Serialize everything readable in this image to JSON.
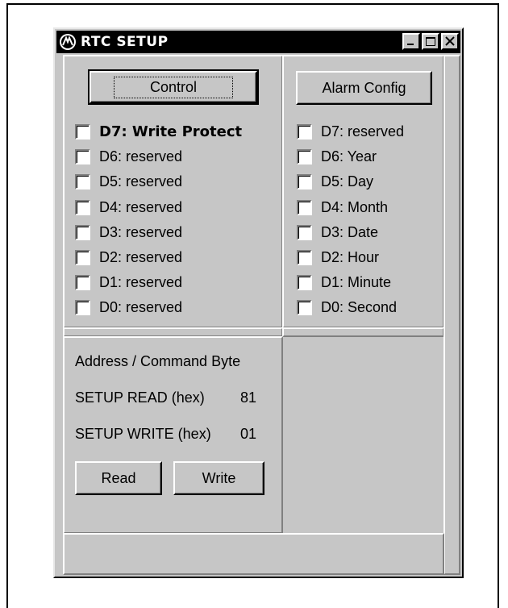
{
  "window": {
    "title": "RTC SETUP"
  },
  "control": {
    "button_label": "Control",
    "bits": [
      {
        "label": "D7: Write Protect",
        "checked": false,
        "bold": true
      },
      {
        "label": "D6: reserved",
        "checked": false
      },
      {
        "label": "D5: reserved",
        "checked": false
      },
      {
        "label": "D4: reserved",
        "checked": false
      },
      {
        "label": "D3: reserved",
        "checked": false
      },
      {
        "label": "D2: reserved",
        "checked": false
      },
      {
        "label": "D1: reserved",
        "checked": false
      },
      {
        "label": "D0: reserved",
        "checked": false
      }
    ]
  },
  "alarm": {
    "button_label": "Alarm Config",
    "bits": [
      {
        "label": "D7: reserved",
        "checked": false
      },
      {
        "label": "D6: Year",
        "checked": false
      },
      {
        "label": "D5: Day",
        "checked": false
      },
      {
        "label": "D4: Month",
        "checked": false
      },
      {
        "label": "D3: Date",
        "checked": false
      },
      {
        "label": "D2: Hour",
        "checked": false
      },
      {
        "label": "D1: Minute",
        "checked": false
      },
      {
        "label": "D0: Second",
        "checked": false
      }
    ]
  },
  "address": {
    "heading": "Address / Command Byte",
    "read_label": "SETUP READ (hex)",
    "read_value": "81",
    "write_label": "SETUP WRITE (hex)",
    "write_value": "01",
    "read_button": "Read",
    "write_button": "Write"
  },
  "icons": {
    "app": "app-logo-icon",
    "minimize": "minimize-icon",
    "maximize": "maximize-icon",
    "close": "close-icon"
  }
}
